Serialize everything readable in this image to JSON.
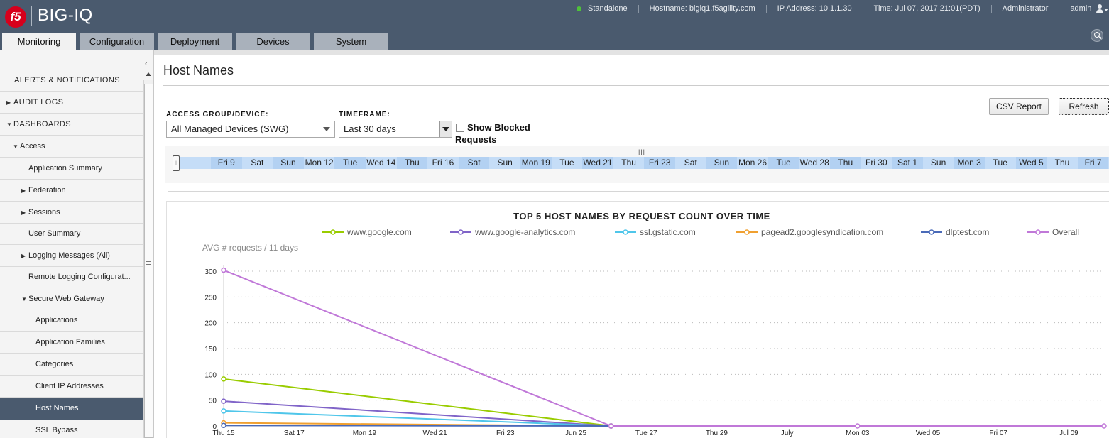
{
  "header": {
    "logo_text": "f5",
    "product": "BIG-IQ",
    "status": "Standalone",
    "hostname": "Hostname: bigiq1.f5agility.com",
    "ip_address": "IP Address: 10.1.1.30",
    "time": "Time: Jul 07, 2017 21:01(PDT)",
    "role": "Administrator",
    "user": "admin",
    "status_color": "#4fc13a"
  },
  "tabs": [
    {
      "label": "Monitoring",
      "active": true
    },
    {
      "label": "Configuration"
    },
    {
      "label": "Deployment"
    },
    {
      "label": "Devices"
    },
    {
      "label": "System"
    }
  ],
  "sidebar": {
    "items": [
      {
        "label": "ALERTS & NOTIFICATIONS"
      },
      {
        "label": "AUDIT LOGS",
        "caret": "▶"
      },
      {
        "label": "DASHBOARDS",
        "caret": "▼"
      },
      {
        "label": "Access",
        "caret": "▼"
      },
      {
        "label": "Application Summary"
      },
      {
        "label": "Federation",
        "caret": "▶"
      },
      {
        "label": "Sessions",
        "caret": "▶"
      },
      {
        "label": "User Summary"
      },
      {
        "label": "Logging Messages (All)",
        "caret": "▶"
      },
      {
        "label": "Remote Logging Configurat..."
      },
      {
        "label": "Secure Web Gateway",
        "caret": "▼"
      },
      {
        "label": "Applications"
      },
      {
        "label": "Application Families"
      },
      {
        "label": "Categories"
      },
      {
        "label": "Client IP Addresses"
      },
      {
        "label": "Host Names",
        "active": true
      },
      {
        "label": "SSL Bypass"
      }
    ]
  },
  "main": {
    "title": "Host Names",
    "csv_button": "CSV Report",
    "refresh_button": "Refresh",
    "access_group_label": "ACCESS GROUP/DEVICE:",
    "access_group_value": "All Managed Devices (SWG)",
    "timeframe_label": "TIMEFRAME:",
    "timeframe_value": "Last 30 days",
    "show_blocked_label": "Show Blocked Requests",
    "timeline_handle": "II",
    "timeline_grip": "|||",
    "timeline_days": [
      "Fri 9",
      "Sat",
      "Sun",
      "Mon 12",
      "Tue",
      "Wed 14",
      "Thu",
      "Fri 16",
      "Sat",
      "Sun",
      "Mon 19",
      "Tue",
      "Wed 21",
      "Thu",
      "Fri 23",
      "Sat",
      "Sun",
      "Mon 26",
      "Tue",
      "Wed 28",
      "Thu",
      "Fri 30",
      "Sat 1",
      "Sun",
      "Mon 3",
      "Tue",
      "Wed 5",
      "Thu",
      "Fri 7"
    ]
  },
  "chart_data": {
    "type": "line",
    "title": "TOP 5 HOST NAMES BY REQUEST COUNT OVER TIME",
    "ylabel": "AVG # requests / 11 days",
    "ylim": [
      0,
      300
    ],
    "yticks": [
      0,
      50,
      100,
      150,
      200,
      250,
      300
    ],
    "grid": true,
    "legend_position": "top",
    "xlim": [
      "2017-06-15",
      "2017-07-10"
    ],
    "xticks": [
      {
        "date": "2017-06-15",
        "label": "Thu 15"
      },
      {
        "date": "2017-06-17",
        "label": "Sat 17"
      },
      {
        "date": "2017-06-19",
        "label": "Mon 19"
      },
      {
        "date": "2017-06-21",
        "label": "Wed 21"
      },
      {
        "date": "2017-06-23",
        "label": "Fri 23"
      },
      {
        "date": "2017-06-25",
        "label": "Jun 25"
      },
      {
        "date": "2017-06-27",
        "label": "Tue 27"
      },
      {
        "date": "2017-06-29",
        "label": "Thu 29"
      },
      {
        "date": "2017-07-01",
        "label": "July"
      },
      {
        "date": "2017-07-03",
        "label": "Mon 03"
      },
      {
        "date": "2017-07-05",
        "label": "Wed 05"
      },
      {
        "date": "2017-07-07",
        "label": "Fri 07"
      },
      {
        "date": "2017-07-09",
        "label": "Jul 09"
      }
    ],
    "x": [
      "2017-06-15",
      "2017-06-26",
      "2017-07-03",
      "2017-07-10"
    ],
    "series": [
      {
        "name": "www.google.com",
        "color": "#99cc00",
        "values": [
          91,
          0,
          null,
          null
        ]
      },
      {
        "name": "www.google-analytics.com",
        "color": "#8064c8",
        "values": [
          48,
          0,
          null,
          null
        ]
      },
      {
        "name": "ssl.gstatic.com",
        "color": "#4fc6ea",
        "values": [
          29,
          0,
          null,
          null
        ]
      },
      {
        "name": "pagead2.googlesyndication.com",
        "color": "#f0a030",
        "values": [
          6,
          0,
          null,
          null
        ]
      },
      {
        "name": "dlptest.com",
        "color": "#4a6ab8",
        "values": [
          1,
          0,
          null,
          null
        ]
      },
      {
        "name": "Overall",
        "color": "#c078d8",
        "values": [
          302,
          0,
          0,
          0
        ]
      }
    ]
  }
}
